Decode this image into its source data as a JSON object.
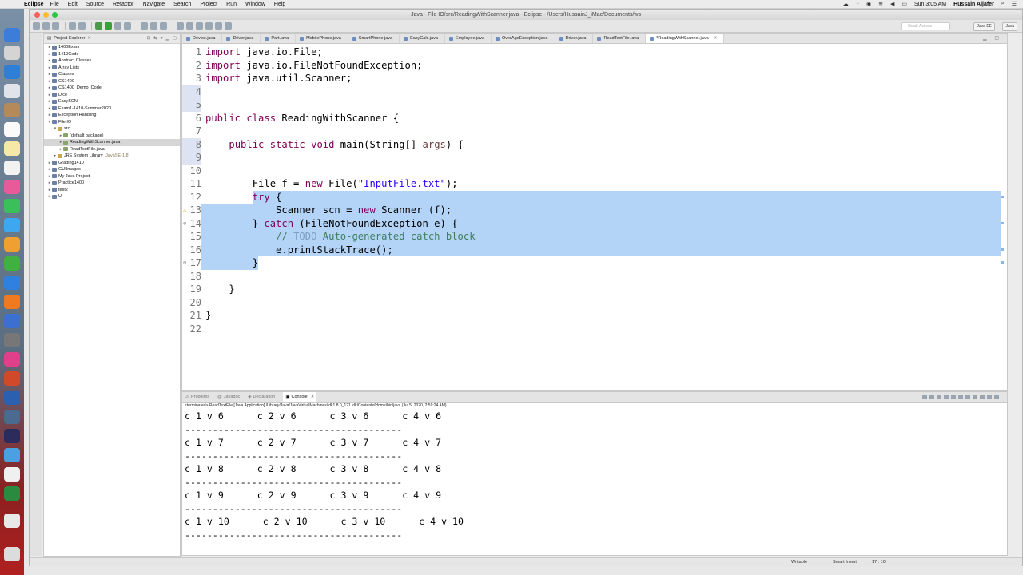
{
  "menubar": {
    "app": "Eclipse",
    "items": [
      "File",
      "Edit",
      "Source",
      "Refactor",
      "Navigate",
      "Search",
      "Project",
      "Run",
      "Window",
      "Help"
    ],
    "datetime": "Sun 3:05 AM",
    "user": "Hussain Aljafer"
  },
  "window": {
    "title": "Java - File IO/src/ReadingWithScanner.java - Eclipse - /Users/HussainJ_iMac/Documents/ws",
    "quick_access_placeholder": "Quick Access",
    "perspectives": [
      "Java EE",
      "Java"
    ]
  },
  "explorer": {
    "tab_label": "Project Explorer",
    "items": [
      {
        "label": "1400Exam",
        "level": 0,
        "expanded": false
      },
      {
        "label": "1410Code",
        "level": 0,
        "expanded": false
      },
      {
        "label": "Abstract Classes",
        "level": 0,
        "expanded": false
      },
      {
        "label": "Array Lists",
        "level": 0,
        "expanded": false
      },
      {
        "label": "Classes",
        "level": 0,
        "expanded": false
      },
      {
        "label": "CS1400",
        "level": 0,
        "expanded": false
      },
      {
        "label": "CS1400_Demo_Code",
        "level": 0,
        "expanded": false
      },
      {
        "label": "Dice",
        "level": 0,
        "expanded": false
      },
      {
        "label": "EasySCN",
        "level": 0,
        "expanded": false
      },
      {
        "label": "Exam1-1410-Summer2020",
        "level": 0,
        "expanded": false
      },
      {
        "label": "Exception Handling",
        "level": 0,
        "expanded": false
      },
      {
        "label": "File IO",
        "level": 0,
        "expanded": true
      },
      {
        "label": "src",
        "level": 1,
        "expanded": true
      },
      {
        "label": "(default package)",
        "level": 2,
        "expanded": false
      },
      {
        "label": "ReadingWithScanner.java",
        "level": 2,
        "expanded": false,
        "selected": true
      },
      {
        "label": "ReadTextFile.java",
        "level": 2,
        "expanded": false
      },
      {
        "label": "JRE System Library",
        "suffix": "[JavaSE-1.8]",
        "level": 1,
        "expanded": false
      },
      {
        "label": "Grading1410",
        "level": 0,
        "expanded": false
      },
      {
        "label": "GUIImages",
        "level": 0,
        "expanded": false
      },
      {
        "label": "My Java Project",
        "level": 0,
        "expanded": false
      },
      {
        "label": "Practice1400",
        "level": 0,
        "expanded": false
      },
      {
        "label": "test2",
        "level": 0,
        "expanded": false
      },
      {
        "label": "UI",
        "level": 0,
        "expanded": false
      }
    ]
  },
  "editor": {
    "tabs": [
      "Device.java",
      "Driver.java",
      "Part.java",
      "MobilePhone.java",
      "SmartPhone.java",
      "EasyCalc.java",
      "Employee.java",
      "OverAgeException.java",
      "Driver.java",
      "ReadTextFile.java",
      "*ReadingWithScanner.java"
    ],
    "active_tab": 10,
    "lines": [
      {
        "n": "1",
        "t": "import java.io.File;"
      },
      {
        "n": "2",
        "t": "import java.io.FileNotFoundException;"
      },
      {
        "n": "3",
        "t": "import java.util.Scanner;"
      },
      {
        "n": "4",
        "t": ""
      },
      {
        "n": "5",
        "t": ""
      },
      {
        "n": "6",
        "t": "public class ReadingWithScanner {"
      },
      {
        "n": "7",
        "t": ""
      },
      {
        "n": "8",
        "t": "    public static void main(String[] args) {"
      },
      {
        "n": "9",
        "t": ""
      },
      {
        "n": "10",
        "t": ""
      },
      {
        "n": "11",
        "t": "        File f = new File(\"InputFile.txt\");"
      },
      {
        "n": "12",
        "t": "        try {"
      },
      {
        "n": "13",
        "t": "            Scanner scn = new Scanner (f);"
      },
      {
        "n": "14",
        "t": "        } catch (FileNotFoundException e) {"
      },
      {
        "n": "15",
        "t": "            // TODO Auto-generated catch block"
      },
      {
        "n": "16",
        "t": "            e.printStackTrace();"
      },
      {
        "n": "17",
        "t": "        }"
      },
      {
        "n": "18",
        "t": ""
      },
      {
        "n": "19",
        "t": "    }"
      },
      {
        "n": "20",
        "t": ""
      },
      {
        "n": "21",
        "t": "}"
      },
      {
        "n": "22",
        "t": ""
      }
    ]
  },
  "console": {
    "tabs": [
      "Problems",
      "Javadoc",
      "Declaration",
      "Console"
    ],
    "active_tab": 3,
    "terminated": "<terminated> ReadTextFile [Java Application] /Library/Java/JavaVirtualMachines/jdk1.8.0_121.jdk/Contents/Home/bin/java (Jul 5, 2020, 2:59:24 AM)",
    "rows": [
      "c 1 v 6      c 2 v 6      c 3 v 6      c 4 v 6",
      "---------------------------------------",
      "c 1 v 7      c 2 v 7      c 3 v 7      c 4 v 7",
      "---------------------------------------",
      "c 1 v 8      c 2 v 8      c 3 v 8      c 4 v 8",
      "---------------------------------------",
      "c 1 v 9      c 2 v 9      c 3 v 9      c 4 v 9",
      "---------------------------------------",
      "c 1 v 10      c 2 v 10      c 3 v 10      c 4 v 10",
      "---------------------------------------"
    ]
  },
  "statusbar": {
    "writable": "Writable",
    "insert_mode": "Smart Insert",
    "position": "17 : 10"
  },
  "colors": {
    "selection": "#b3d3f7",
    "keyword": "#7f0055",
    "string": "#2a00ff",
    "comment": "#3f7f5f"
  }
}
